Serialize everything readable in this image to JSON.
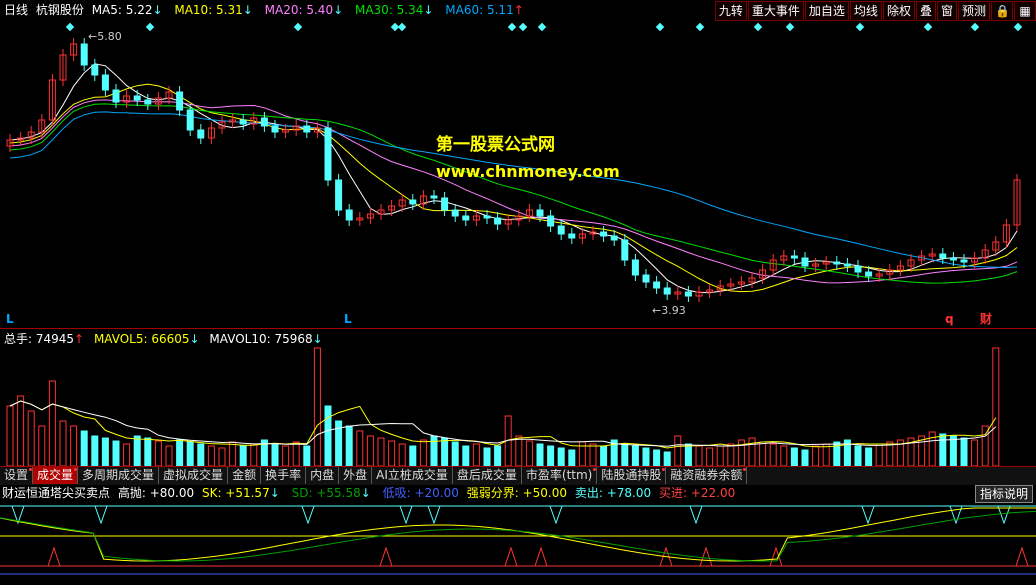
{
  "header": {
    "period": "日线",
    "stock": "杭钢股份",
    "ma5": "MA5: 5.22",
    "ma10": "MA10: 5.31",
    "ma20": "MA20: 5.40",
    "ma30": "MA30: 5.34",
    "ma60": "MA60: 5.11"
  },
  "toolbar": [
    "九转",
    "重大事件",
    "加自选",
    "均线",
    "除权",
    "叠",
    "窗",
    "预测"
  ],
  "price_chart": {
    "high_label": "5.80",
    "low_label": "3.93",
    "markers": [
      "L",
      "L",
      "q",
      "财"
    ]
  },
  "watermark": {
    "line1": "第一股票公式网",
    "line2": "www.chnmoney.com"
  },
  "volume": {
    "total": "总手: 74945",
    "mavol5": "MAVOL5: 66605",
    "mavol10": "MAVOL10: 75968"
  },
  "tabs": [
    "设置",
    "成交量",
    "多周期成交量",
    "虚拟成交量",
    "金额",
    "换手率",
    "内盘",
    "外盘",
    "AI立桩成交量",
    "盘后成交量",
    "市盈率(ttm)",
    "陆股通持股",
    "融资融券余额"
  ],
  "indicator": {
    "name": "财运恒通塔尖买卖点",
    "gaopao": "高抛: +80.00",
    "sk": "SK: +51.57",
    "sd": "SD: +55.58",
    "dixi": "低吸: +20.00",
    "qrfj": "强弱分界: +50.00",
    "maichu": "卖出: +78.00",
    "mairu": "买进: +22.00",
    "help": "指标说明"
  },
  "colors": {
    "up": "#ff3232",
    "down": "#54ffff",
    "ma5": "#ffffff",
    "ma10": "#ffff00",
    "ma20": "#ff80ff",
    "ma30": "#00e000",
    "ma60": "#00a8ff",
    "border": "#a00000"
  }
}
